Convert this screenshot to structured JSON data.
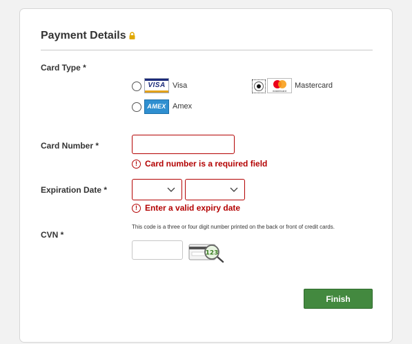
{
  "form": {
    "title": "Payment Details",
    "card_type": {
      "label": "Card Type *",
      "options": [
        {
          "name": "Visa",
          "logo_text": "VISA",
          "selected": false
        },
        {
          "name": "Mastercard",
          "logo_text": "mastercard",
          "selected": true
        },
        {
          "name": "Amex",
          "logo_text": "AMEX",
          "selected": false
        }
      ]
    },
    "card_number": {
      "label": "Card Number *",
      "value": "",
      "error": "Card number is a required field"
    },
    "expiration": {
      "label": "Expiration Date *",
      "month_value": "",
      "year_value": "",
      "error": "Enter a valid expiry date"
    },
    "cvn": {
      "label": "CVN *",
      "help_text": "This code is a three or four digit number printed on the back or front of credit cards.",
      "value": "",
      "icon_text": "123"
    },
    "finish_label": "Finish"
  },
  "colors": {
    "error": "#b30000",
    "finish_button": "#43893f",
    "lock_icon": "#e0a800"
  },
  "icons": [
    "lock-icon",
    "visa-logo",
    "mastercard-logo",
    "amex-logo",
    "chevron-down-icon",
    "error-icon",
    "cvn-card-magnifier-icon"
  ]
}
